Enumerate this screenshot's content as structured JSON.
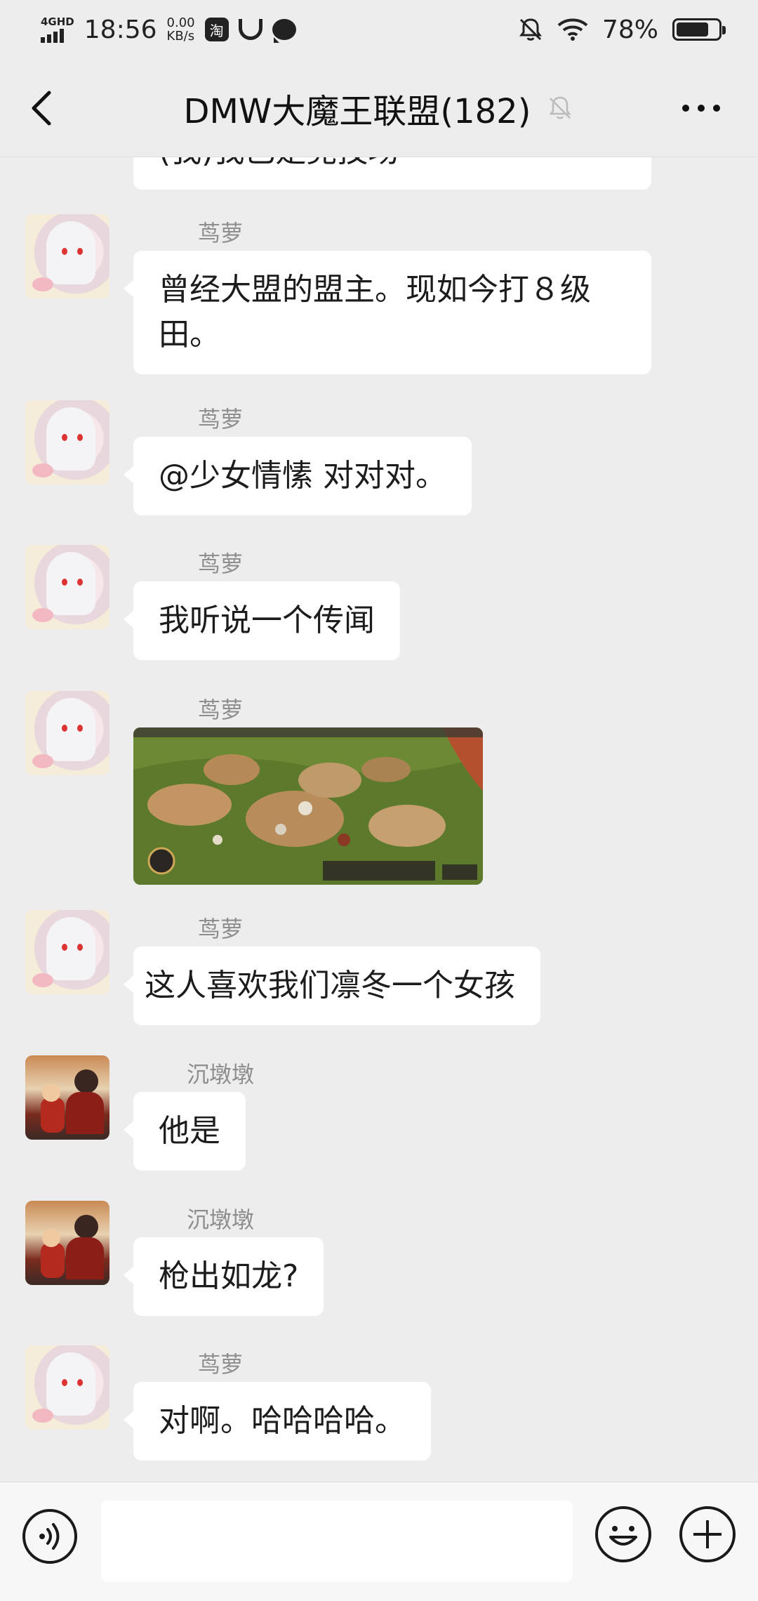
{
  "status_bar": {
    "network": "4GHD",
    "time": "18:56",
    "speed_value": "0.00",
    "speed_unit": "KB/s",
    "taobao_glyph": "淘",
    "battery": "78%",
    "battery_level": 0.78,
    "icons": [
      "signal-icon",
      "taobao-icon",
      "ring-icon",
      "chat-icon",
      "mute-bell-icon",
      "wifi-icon",
      "battery-icon"
    ]
  },
  "header": {
    "title": "DMW大魔王联盟(182)",
    "icons": [
      "back-arrow-icon",
      "mute-bell-icon",
      "more-icon"
    ]
  },
  "messages": [
    {
      "type": "partial_text",
      "text": "(我)我已是竞技场"
    },
    {
      "sender": "茑萝",
      "avatar": "girl",
      "text": "曾经大盟的盟主。现如今打８级田。"
    },
    {
      "sender": "茑萝",
      "avatar": "girl",
      "text": "@少女情愫  对对对。"
    },
    {
      "sender": "茑萝",
      "avatar": "girl",
      "text": "我听说一个传闻"
    },
    {
      "sender": "茑萝",
      "avatar": "girl",
      "type": "image",
      "image_desc": "game-screenshot"
    },
    {
      "sender": "茑萝",
      "avatar": "girl",
      "text": "这人喜欢我们凛冬一个女孩"
    },
    {
      "sender": "沉墩墩",
      "avatar": "photo",
      "text": "他是"
    },
    {
      "sender": "沉墩墩",
      "avatar": "photo",
      "text": "枪出如龙?"
    },
    {
      "sender": "茑萝",
      "avatar": "girl",
      "text": "对啊。哈哈哈哈。"
    }
  ],
  "input_bar": {
    "placeholder": "",
    "icons": [
      "voice-icon",
      "emoji-icon",
      "plus-icon"
    ]
  },
  "colors": {
    "background": "#ededed",
    "bubble": "#ffffff",
    "sender_text": "#8e8e8e"
  }
}
